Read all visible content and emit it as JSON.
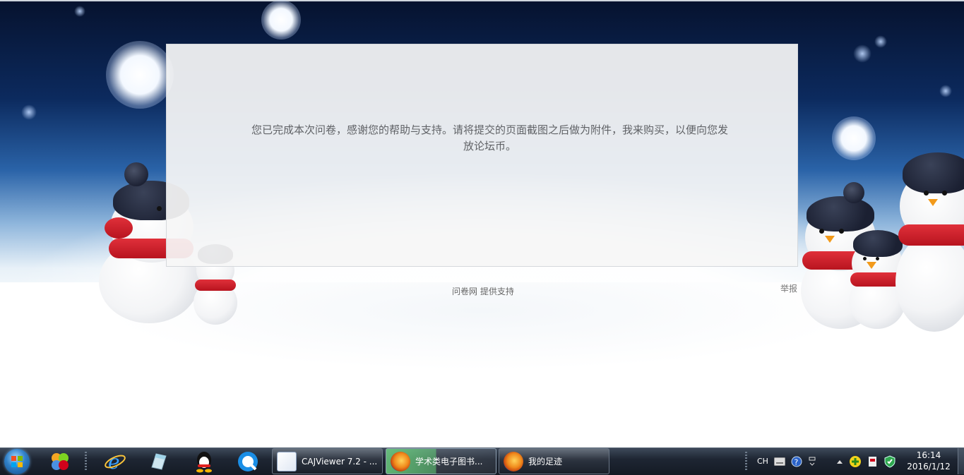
{
  "dialog": {
    "message": "您已完成本次问卷，感谢您的帮助与支持。请将提交的页面截图之后做为附件，我来购买，以便向您发放论坛币。"
  },
  "footer": {
    "powered_by": "问卷网  提供支持",
    "report_label": "举报"
  },
  "taskbar": {
    "pinned": [
      "windows-start-icon",
      "media-center-icon",
      "internet-explorer-icon",
      "notes-icon",
      "qq-icon",
      "browser-icon"
    ],
    "tasks": [
      {
        "label": "CAJViewer 7.2 - ...",
        "icon": "cajviewer-icon",
        "active": false
      },
      {
        "label": "学术类电子图书...",
        "icon": "firefox-icon",
        "active": true
      },
      {
        "label": "我的足迹",
        "icon": "firefox-icon",
        "active": false
      }
    ],
    "tray": {
      "language": "CH",
      "time": "16:14",
      "date": "2016/1/12"
    }
  },
  "colors": {
    "dialog_bg": "#f6f6f6",
    "message_text": "#606266",
    "taskbar_bg": "#1e2633",
    "active_task": "#78e68c",
    "scarf_red": "#d4202b"
  }
}
